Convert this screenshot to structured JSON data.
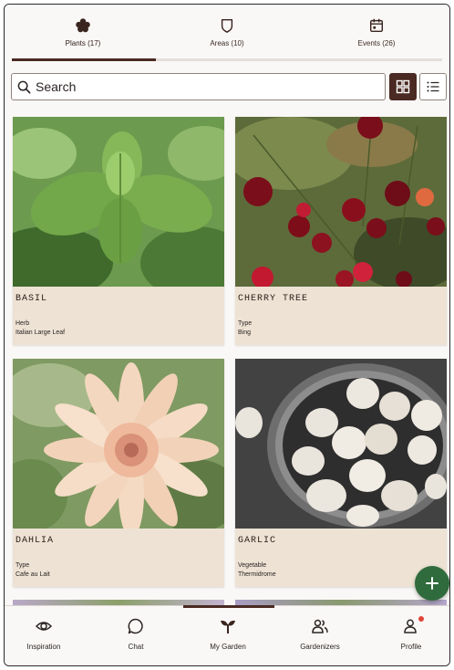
{
  "top_tabs": [
    {
      "label": "Plants (17)",
      "icon": "flower-icon",
      "active": true
    },
    {
      "label": "Areas (10)",
      "icon": "shield-icon",
      "active": false
    },
    {
      "label": "Events (26)",
      "icon": "calendar-icon",
      "active": false
    }
  ],
  "search": {
    "placeholder": "Search"
  },
  "view_toggle": {
    "active": "grid"
  },
  "plants": [
    {
      "name": "BASIL",
      "line1": "Herb",
      "line2": "Italian Large Leaf"
    },
    {
      "name": "CHERRY TREE",
      "line1": "Type",
      "line2": "Bing"
    },
    {
      "name": "DAHLIA",
      "line1": "Type",
      "line2": "Cafe au Lait"
    },
    {
      "name": "GARLIC",
      "line1": "Vegetable",
      "line2": "Thermidrome"
    }
  ],
  "bottom_nav": [
    {
      "label": "Inspiration",
      "icon": "eye-icon"
    },
    {
      "label": "Chat",
      "icon": "chat-bubble-icon"
    },
    {
      "label": "My Garden",
      "icon": "sprout-icon",
      "active": true
    },
    {
      "label": "Gardenizers",
      "icon": "people-icon"
    },
    {
      "label": "Profile",
      "icon": "profile-icon",
      "has_notification": true
    }
  ],
  "colors": {
    "accent": "#4a2a22",
    "card_bg": "#ede2d4",
    "fab": "#2f6b3c",
    "notification": "#e0453a"
  }
}
